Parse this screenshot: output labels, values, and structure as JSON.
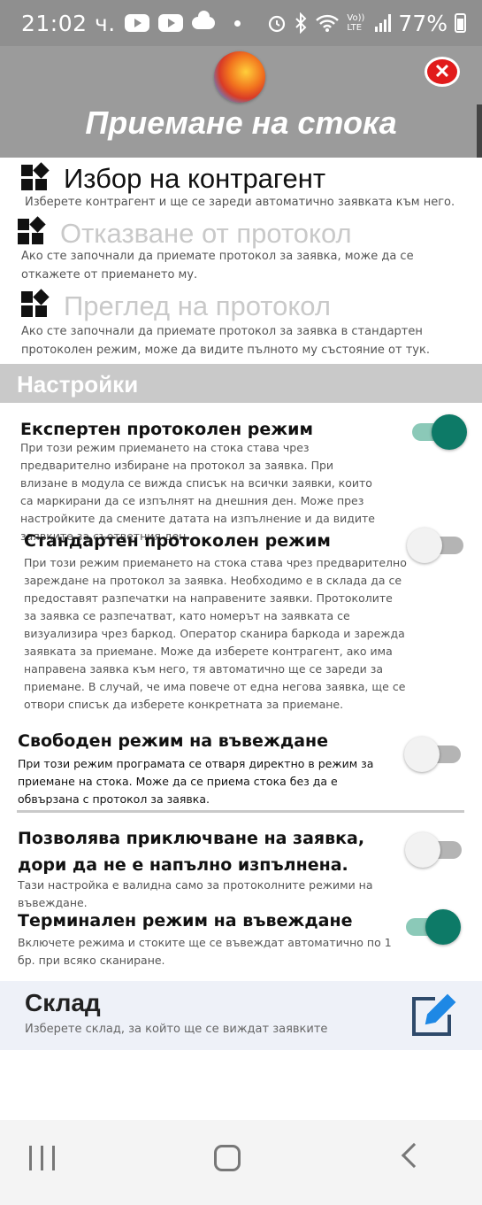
{
  "status_bar": {
    "time": "21:02 ч.",
    "network": "Vo)) LTE",
    "battery_percent": "77%"
  },
  "header": {
    "title": "Приемане на стока",
    "close_icon": "close-icon"
  },
  "menu": [
    {
      "label": "Избор на контрагент",
      "description": "Изберете контрагент и ще се зареди автоматично заявката към него.",
      "enabled": true
    },
    {
      "label": "Отказване от протокол",
      "description": "Ако сте започнали да приемате протокол за заявка, може да се откажете от приемането му.",
      "enabled": false
    },
    {
      "label": "Преглед на протокол",
      "description": "Ако сте започнали да приемате протокол за заявка в стандартен протоколен режим, може да видите пълното му състояние от тук.",
      "enabled": false
    }
  ],
  "settings": {
    "header": "Настройки",
    "options": [
      {
        "title": "Експертен протоколен режим",
        "description": "При този режим приемането на стока става чрез предварително избиране на протокол за заявка. При влизане в модула се вижда списък на всички заявки, които са маркирани да се изпълнят на днешния ден. Може през настройките да смените датата на изпълнение и да видите заявките за съответния ден.",
        "enabled": true
      },
      {
        "title": "Стандартен протоколен режим",
        "description": "При този режим приемането на стока става чрез предварително зареждане на протокол за заявка. Необходимо е в склада да се предоставят разпечатки на направените заявки. Протоколите за заявка се разпечатват, като номерът на заявката се визуализира чрез баркод. Оператор сканира баркода и зарежда заявката за приемане. Може да изберете контрагент, ако има направена заявка към него, тя автоматично ще се зареди за приемане. В случай, че има повече от една негова заявка, ще се отвори списък да изберете конкретната за приемане.",
        "enabled": false
      },
      {
        "title": "Свободен режим на въвеждане",
        "description": "При този режим програмата се отваря директно в режим за приемане на стока. Може да се приема стока без да е обвързана с протокол за заявка.",
        "enabled": false
      },
      {
        "title": "Позволява приключване на заявка, дори да не е напълно изпълнена.",
        "description": "Тази настройка е валидна само за протоколните режими на въвеждане.",
        "enabled": false
      },
      {
        "title": "Терминален режим на въвеждане",
        "description": "Включете режима и стоките ще се въвеждат автоматично по 1 бр. при всяко сканиране.",
        "enabled": true
      }
    ]
  },
  "warehouse": {
    "title": "Склад",
    "description": "Изберете склад, за който ще се виждат заявките",
    "edit_icon": "edit-icon"
  },
  "nav": {
    "recent_icon": "recent-apps-icon",
    "home_icon": "home-icon",
    "back_icon": "back-icon"
  },
  "colors": {
    "header_bg": "#9b9b9b",
    "toggle_on": "#0d7a67",
    "close_red": "#e11b1b",
    "edit_blue": "#1e88e5"
  }
}
